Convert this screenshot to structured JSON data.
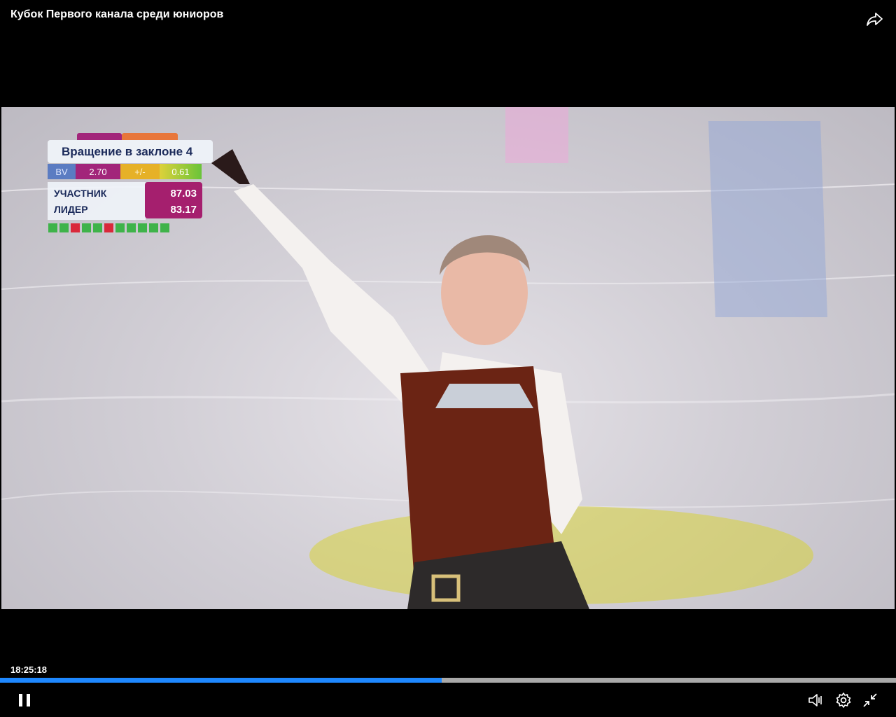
{
  "player": {
    "title": "Кубок Первого канала среди юниоров",
    "timestamp": "18:25:18",
    "progress_fraction": 0.493,
    "accent_color": "#1e88ff"
  },
  "score_graphic": {
    "element_name": "Вращение в заклоне 4",
    "bv_label": "BV",
    "bv_value": "2.70",
    "goe_label": "+/-",
    "goe_value": "0.61",
    "participant_label": "УЧАСТНИК",
    "participant_score": "87.03",
    "leader_label": "ЛИДЕР",
    "leader_score": "83.17",
    "element_markers": [
      "green",
      "green",
      "red",
      "green",
      "green",
      "red",
      "green",
      "green",
      "green",
      "green",
      "green"
    ]
  },
  "controls": {
    "share_icon": "share-icon",
    "pause_icon": "pause-icon",
    "volume_icon": "volume-icon",
    "settings_icon": "gear-icon",
    "exit_fullscreen_icon": "exit-fullscreen-icon"
  }
}
